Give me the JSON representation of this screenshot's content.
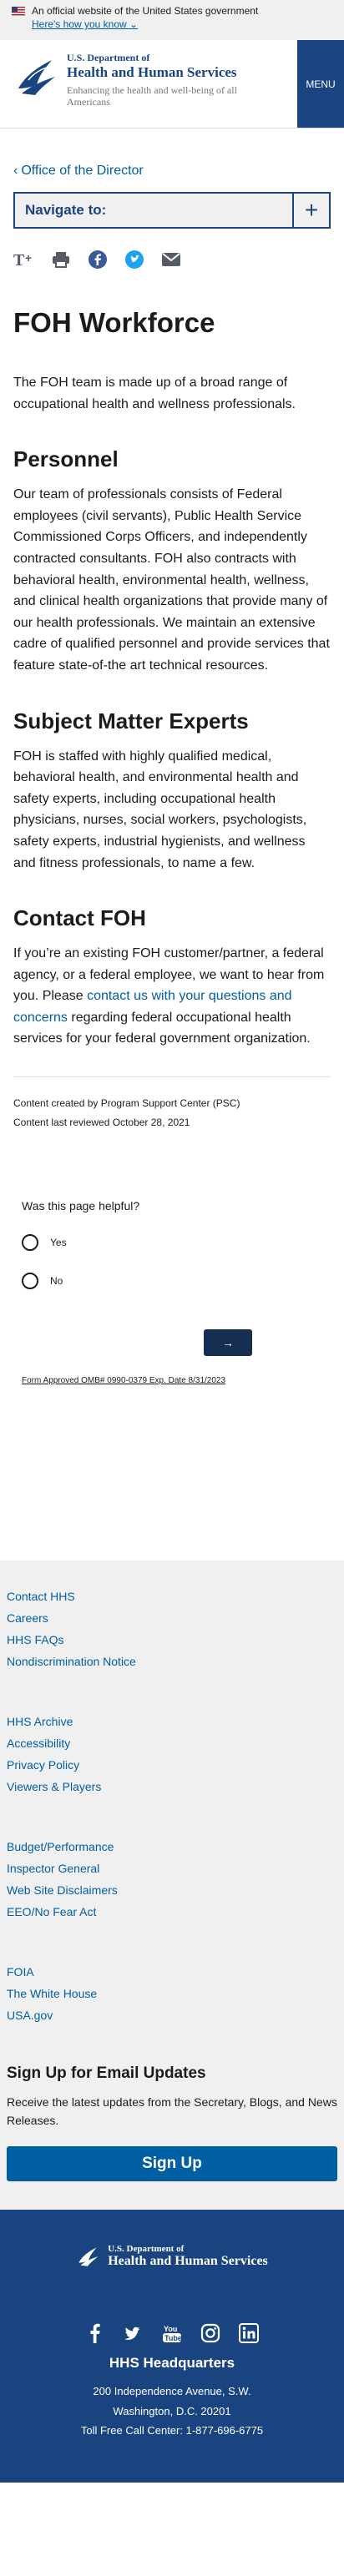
{
  "gov_banner": {
    "official": "An official website of the United States government",
    "how_know": "Here's how you know"
  },
  "header": {
    "logo_line1": "U.S. Department of",
    "logo_line2": "Health and Human Services",
    "tagline": "Enhancing the health and well-being of all Americans",
    "menu_label": "MENU"
  },
  "breadcrumb": {
    "back_link": "Office of the Director"
  },
  "navigate": {
    "label": "Navigate to:"
  },
  "share_icons": [
    "text-size-icon",
    "print-icon",
    "facebook-icon",
    "twitter-icon",
    "email-icon"
  ],
  "content": {
    "title": "FOH Workforce",
    "intro": "The FOH team is made up of a broad range of occupational health and wellness professionals.",
    "personnel_heading": "Personnel",
    "personnel_text": "Our team of professionals consists of Federal employees (civil servants), Public Health Service Commissioned Corps Officers, and independently contracted consultants. FOH also contracts with behavioral health, environmental health, wellness, and clinical health organizations that provide many of our health professionals. We maintain an extensive cadre of qualified personnel and provide services that feature state-of-the art technical resources.",
    "sme_heading": "Subject Matter Experts",
    "sme_text": "FOH is staffed with highly qualified medical, behavioral health, and environmental health and safety experts, including occupational health physicians, nurses, social workers, psychologists, safety experts, industrial hygienists, and wellness and fitness professionals, to name a few.",
    "contact_heading": "Contact FOH",
    "contact_before": "If you’re an existing FOH customer/partner, a federal agency, or a federal employee, we want to hear from you. Please ",
    "contact_link": "contact us with your questions and concerns",
    "contact_after": " regarding federal occupational health services for your federal government organization.",
    "created_by": "Content created by Program Support Center (PSC)",
    "reviewed": "Content last reviewed October 28, 2021"
  },
  "feedback": {
    "question": "Was this page helpful?",
    "yes": "Yes",
    "no": "No",
    "submit_arrow": "→",
    "omb": "Form Approved OMB# 0990-0379 Exp. Date 8/31/2023"
  },
  "footer_links": {
    "group1": [
      "Contact HHS",
      "Careers",
      "HHS FAQs",
      "Nondiscrimination Notice"
    ],
    "group2": [
      "HHS Archive",
      "Accessibility",
      "Privacy Policy",
      "Viewers & Players"
    ],
    "group3": [
      "Budget/Performance",
      "Inspector General",
      "Web Site Disclaimers",
      "EEO/No Fear Act"
    ],
    "group4": [
      "FOIA",
      "The White House",
      "USA.gov"
    ]
  },
  "signup": {
    "heading": "Sign Up for Email Updates",
    "text": "Receive the latest updates from the Secretary, Blogs, and News Releases.",
    "button": "Sign Up"
  },
  "footer": {
    "logo_line1": "U.S. Department of",
    "logo_line2": "Health and Human Services",
    "social": [
      "facebook-icon",
      "twitter-icon",
      "youtube-icon",
      "instagram-icon",
      "linkedin-icon"
    ],
    "hq": "HHS Headquarters",
    "addr1": "200 Independence Avenue, S.W.",
    "addr2": "Washington, D.C. 20201",
    "phone": "Toll Free Call Center: 1-877-696-6775"
  },
  "colors": {
    "primary": "#1a4480",
    "link": "#005ea2",
    "banner_bg": "#f0f0f0",
    "submit": "#162e51"
  }
}
